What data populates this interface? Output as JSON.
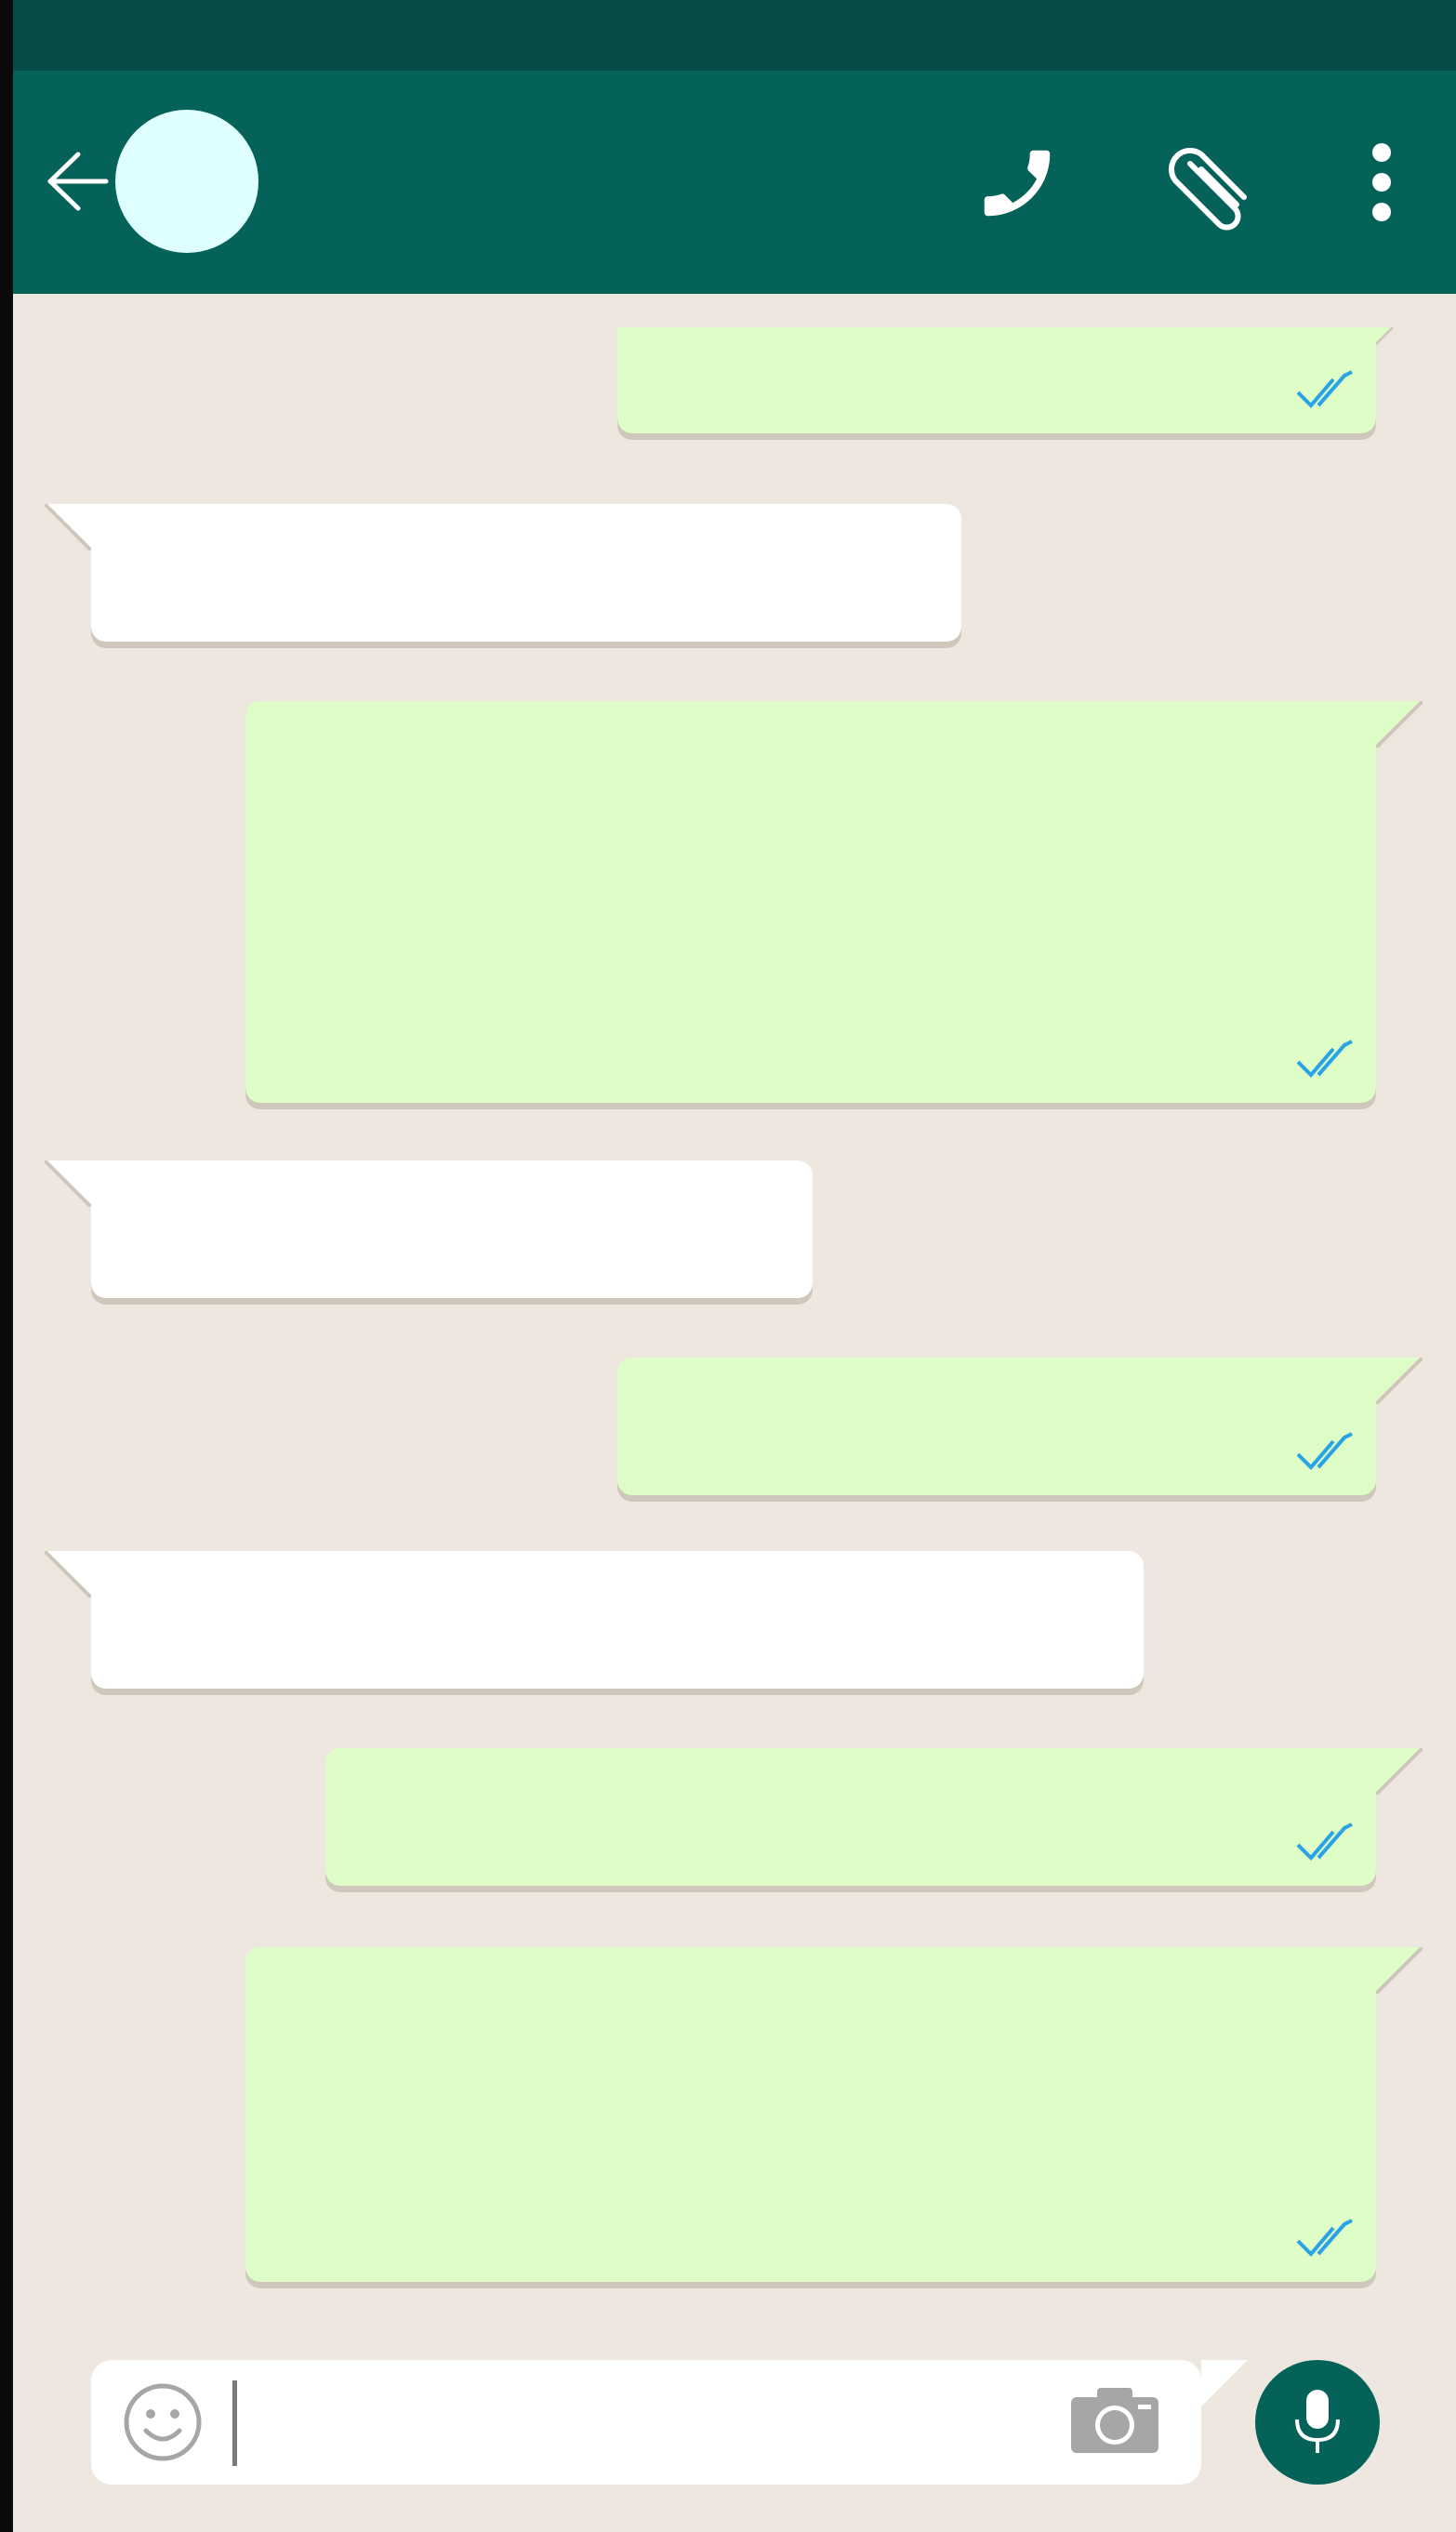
{
  "app": {
    "title": ""
  },
  "header": {
    "contact_name": "",
    "back_icon": "arrow-left",
    "call_icon": "phone",
    "attach_icon": "paperclip",
    "menu_icon": "vertical-ellipsis"
  },
  "messages": [
    {
      "direction": "outgoing",
      "text": "",
      "status": "read"
    },
    {
      "direction": "incoming",
      "text": ""
    },
    {
      "direction": "outgoing",
      "text": "",
      "status": "read"
    },
    {
      "direction": "incoming",
      "text": ""
    },
    {
      "direction": "outgoing",
      "text": "",
      "status": "read"
    },
    {
      "direction": "incoming",
      "text": ""
    },
    {
      "direction": "outgoing",
      "text": "",
      "status": "read"
    },
    {
      "direction": "outgoing",
      "text": "",
      "status": "read"
    }
  ],
  "composer": {
    "value": "",
    "placeholder": "",
    "emoji_icon": "smiley",
    "camera_icon": "camera",
    "mic_icon": "microphone"
  },
  "colors": {
    "status_bar": "#054b46",
    "header": "#056259",
    "chat_background": "#ede7df",
    "outgoing_bubble": "#dffdc6",
    "incoming_bubble": "#ffffff",
    "read_ticks": "#2aa3e6",
    "avatar": "#dffeff"
  }
}
